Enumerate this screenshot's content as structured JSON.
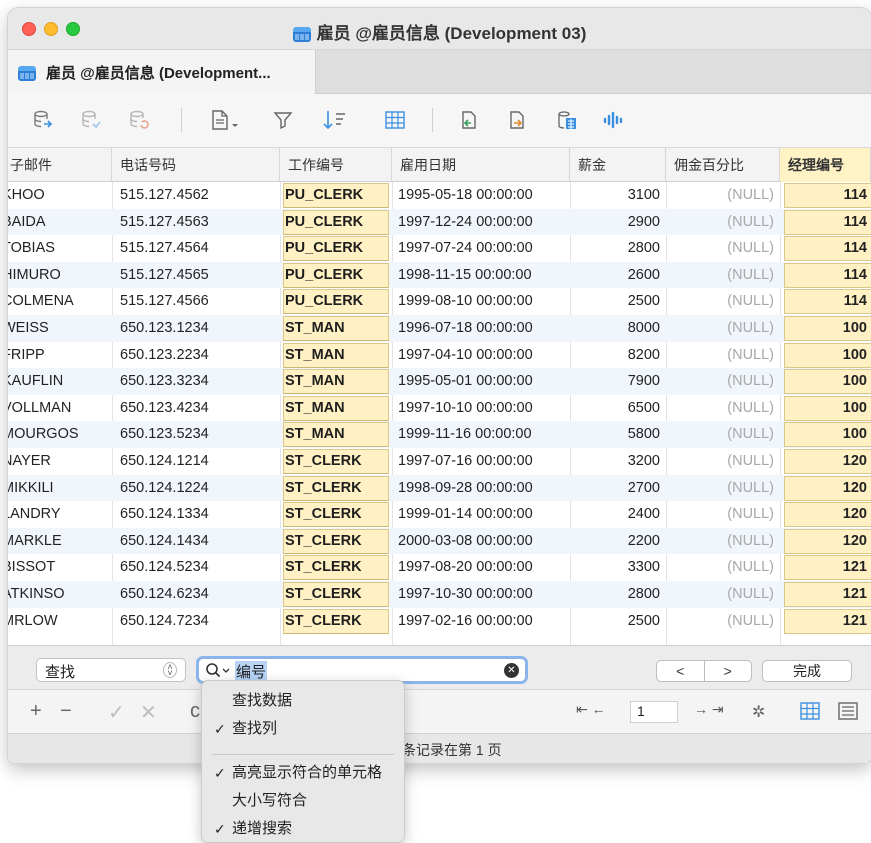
{
  "window": {
    "title": "雇员 @雇员信息 (Development 03)",
    "tab_label": "雇员 @雇员信息 (Development..."
  },
  "toolbar": {
    "icons": [
      "db-import-icon",
      "db-export-icon",
      "db-refresh-icon",
      "document-menu-icon",
      "filter-icon",
      "sort-icon",
      "grid-icon",
      "copy-left-icon",
      "copy-right-icon",
      "calculator-icon",
      "waveform-icon"
    ]
  },
  "grid": {
    "columns": [
      "子邮件",
      "电话号码",
      "工作编号",
      "雇用日期",
      "薪金",
      "佣金百分比",
      "经理编号"
    ],
    "rows": [
      {
        "email": "KHOO",
        "phone": "515.127.4562",
        "job": "PU_CLERK",
        "date": "1995-05-18 00:00:00",
        "salary": "3100",
        "commission": "(NULL)",
        "manager": "114"
      },
      {
        "email": "BAIDA",
        "phone": "515.127.4563",
        "job": "PU_CLERK",
        "date": "1997-12-24 00:00:00",
        "salary": "2900",
        "commission": "(NULL)",
        "manager": "114"
      },
      {
        "email": "TOBIAS",
        "phone": "515.127.4564",
        "job": "PU_CLERK",
        "date": "1997-07-24 00:00:00",
        "salary": "2800",
        "commission": "(NULL)",
        "manager": "114"
      },
      {
        "email": "HIMURO",
        "phone": "515.127.4565",
        "job": "PU_CLERK",
        "date": "1998-11-15 00:00:00",
        "salary": "2600",
        "commission": "(NULL)",
        "manager": "114"
      },
      {
        "email": "COLMENA",
        "phone": "515.127.4566",
        "job": "PU_CLERK",
        "date": "1999-08-10 00:00:00",
        "salary": "2500",
        "commission": "(NULL)",
        "manager": "114"
      },
      {
        "email": "WEISS",
        "phone": "650.123.1234",
        "job": "ST_MAN",
        "date": "1996-07-18 00:00:00",
        "salary": "8000",
        "commission": "(NULL)",
        "manager": "100"
      },
      {
        "email": "FRIPP",
        "phone": "650.123.2234",
        "job": "ST_MAN",
        "date": "1997-04-10 00:00:00",
        "salary": "8200",
        "commission": "(NULL)",
        "manager": "100"
      },
      {
        "email": "KAUFLIN",
        "phone": "650.123.3234",
        "job": "ST_MAN",
        "date": "1995-05-01 00:00:00",
        "salary": "7900",
        "commission": "(NULL)",
        "manager": "100"
      },
      {
        "email": "VOLLMAN",
        "phone": "650.123.4234",
        "job": "ST_MAN",
        "date": "1997-10-10 00:00:00",
        "salary": "6500",
        "commission": "(NULL)",
        "manager": "100"
      },
      {
        "email": "MOURGOS",
        "phone": "650.123.5234",
        "job": "ST_MAN",
        "date": "1999-11-16 00:00:00",
        "salary": "5800",
        "commission": "(NULL)",
        "manager": "100"
      },
      {
        "email": "NAYER",
        "phone": "650.124.1214",
        "job": "ST_CLERK",
        "date": "1997-07-16 00:00:00",
        "salary": "3200",
        "commission": "(NULL)",
        "manager": "120"
      },
      {
        "email": "MIKKILI",
        "phone": "650.124.1224",
        "job": "ST_CLERK",
        "date": "1998-09-28 00:00:00",
        "salary": "2700",
        "commission": "(NULL)",
        "manager": "120"
      },
      {
        "email": "LANDRY",
        "phone": "650.124.1334",
        "job": "ST_CLERK",
        "date": "1999-01-14 00:00:00",
        "salary": "2400",
        "commission": "(NULL)",
        "manager": "120"
      },
      {
        "email": "MARKLE",
        "phone": "650.124.1434",
        "job": "ST_CLERK",
        "date": "2000-03-08 00:00:00",
        "salary": "2200",
        "commission": "(NULL)",
        "manager": "120"
      },
      {
        "email": "BISSOT",
        "phone": "650.124.5234",
        "job": "ST_CLERK",
        "date": "1997-08-20 00:00:00",
        "salary": "3300",
        "commission": "(NULL)",
        "manager": "121"
      },
      {
        "email": "ATKINSO",
        "phone": "650.124.6234",
        "job": "ST_CLERK",
        "date": "1997-10-30 00:00:00",
        "salary": "2800",
        "commission": "(NULL)",
        "manager": "121"
      },
      {
        "email": "MRLOW",
        "phone": "650.124.7234",
        "job": "ST_CLERK",
        "date": "1997-02-16 00:00:00",
        "salary": "2500",
        "commission": "(NULL)",
        "manager": "121"
      }
    ]
  },
  "findbar": {
    "mode_label": "查找",
    "search_value": "编号",
    "prev_label": "<",
    "next_label": ">",
    "done_label": "完成"
  },
  "pager": {
    "page_value": "1"
  },
  "status": {
    "text": "条记录在第 1 页"
  },
  "menu": {
    "items": [
      {
        "label": "查找数据",
        "checked": false
      },
      {
        "label": "查找列",
        "checked": true
      },
      {
        "label": "高亮显示符合的单元格",
        "checked": true
      },
      {
        "label": "大小写符合",
        "checked": false
      },
      {
        "label": "递增搜索",
        "checked": true
      }
    ],
    "check_glyph": "✓"
  },
  "colors": {
    "highlight_cell": "#fff1c4",
    "search_focus": "#8ab4ea",
    "null_text": "#a8a8a8"
  }
}
